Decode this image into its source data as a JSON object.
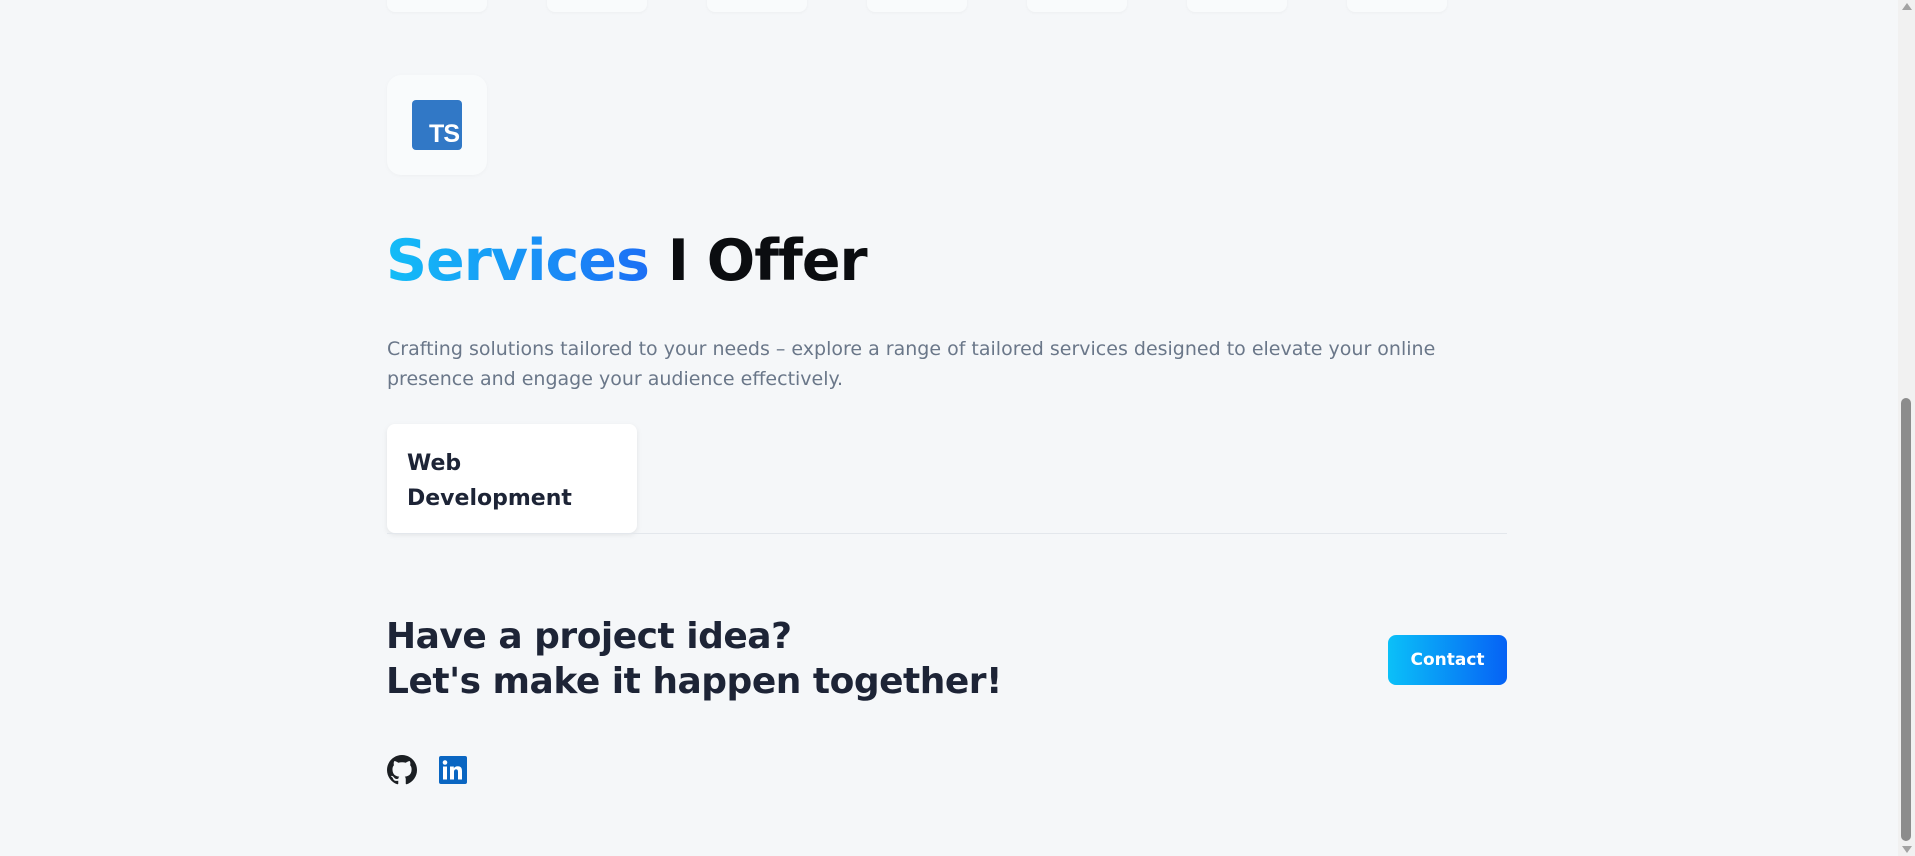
{
  "tech": {
    "ts_logo_text": "TS",
    "ts_icon": "typescript-icon"
  },
  "services": {
    "title_highlight": "Services",
    "title_rest": " I Offer",
    "description": "Crafting solutions tailored to your needs – explore a range of tailored services designed to elevate your online presence and engage your audience effectively.",
    "tabs": [
      {
        "label": "Web Development",
        "selected": true
      }
    ]
  },
  "cta": {
    "line1": "Have a project idea?",
    "line2": "Let's make it happen together!",
    "button_label": "Contact"
  },
  "social": [
    {
      "icon": "github-icon"
    },
    {
      "icon": "linkedin-icon"
    }
  ],
  "colors": {
    "background": "#f5f7f9",
    "accent_gradient_start": "#13bdf7",
    "accent_gradient_end": "#1d6ff5",
    "typescript_blue": "#3178c6",
    "linkedin_blue": "#0a66c2",
    "heading_dark": "#1d2436",
    "muted_text": "#6a7789"
  }
}
